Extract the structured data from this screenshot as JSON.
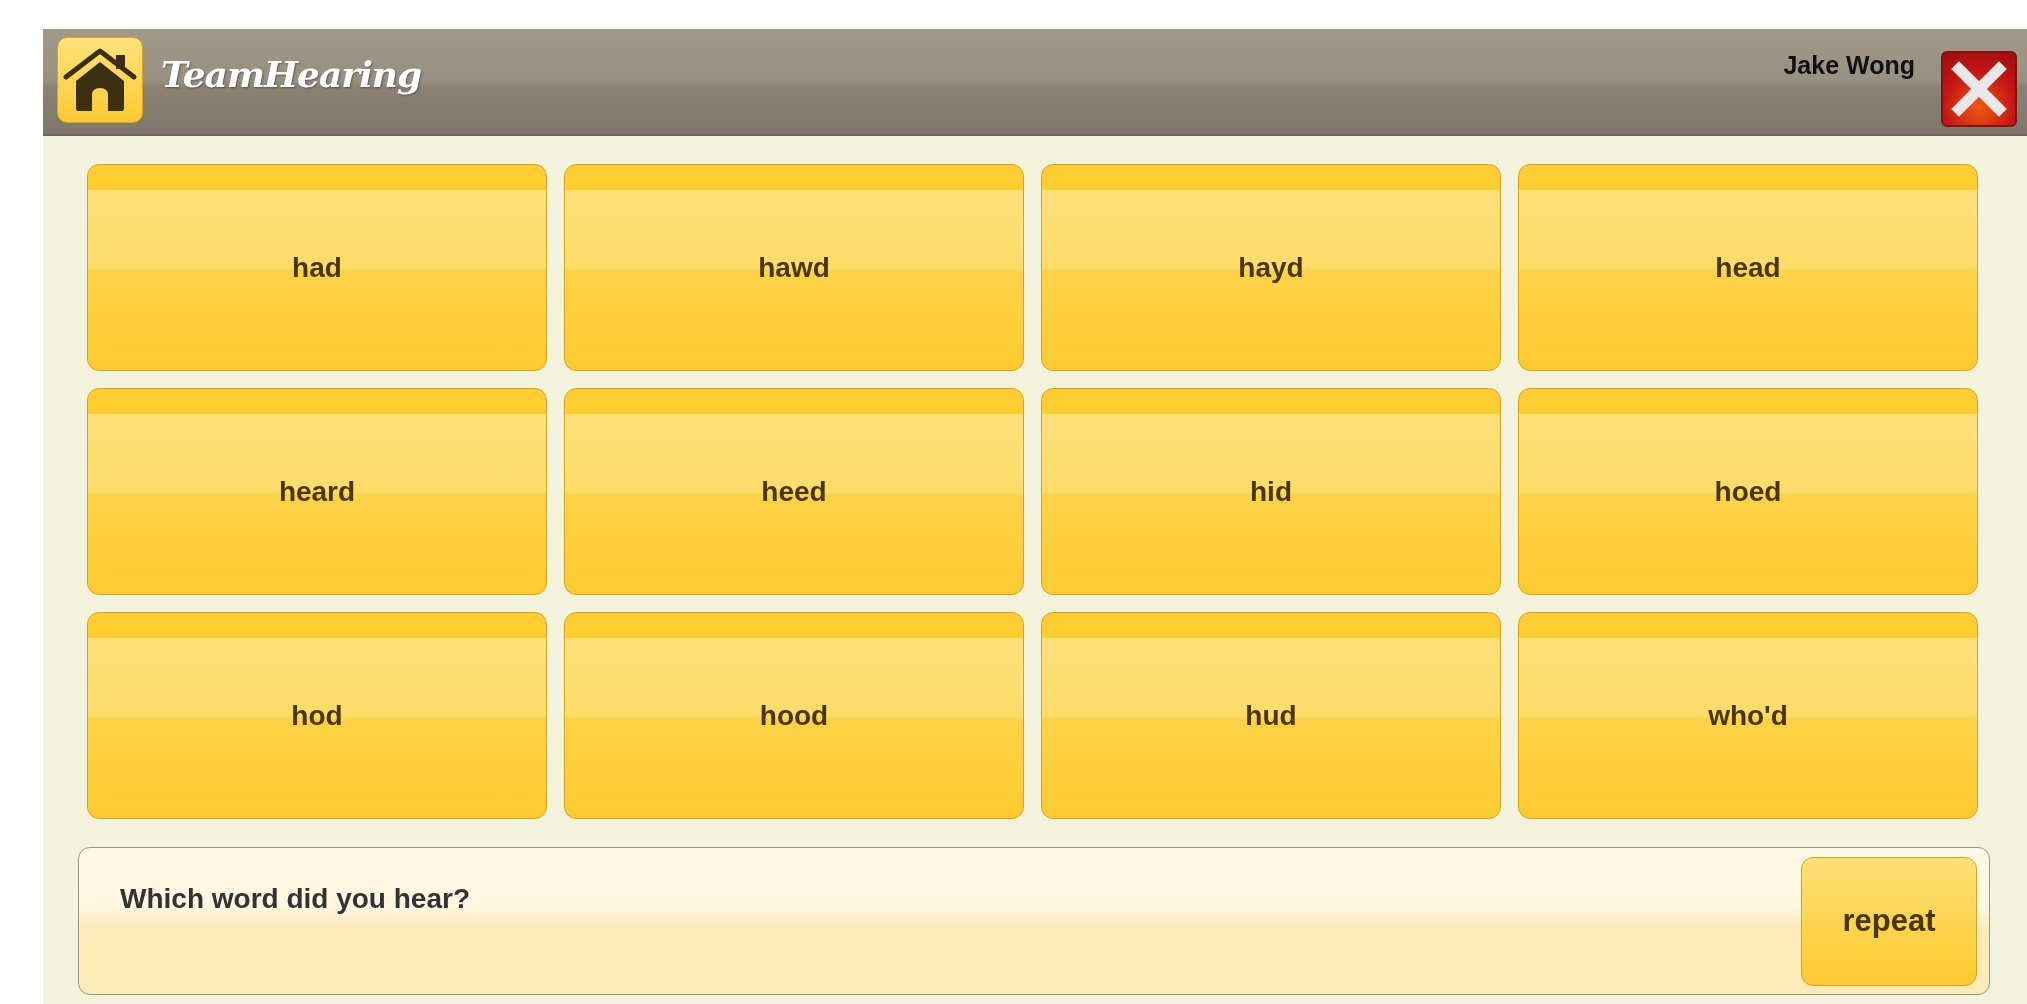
{
  "header": {
    "title": "TeamHearing",
    "user": "Jake Wong"
  },
  "words": [
    "had",
    "hawd",
    "hayd",
    "head",
    "heard",
    "heed",
    "hid",
    "hoed",
    "hod",
    "hood",
    "hud",
    "who'd"
  ],
  "prompt": {
    "question": "Which word did you hear?",
    "button": "repeat"
  }
}
